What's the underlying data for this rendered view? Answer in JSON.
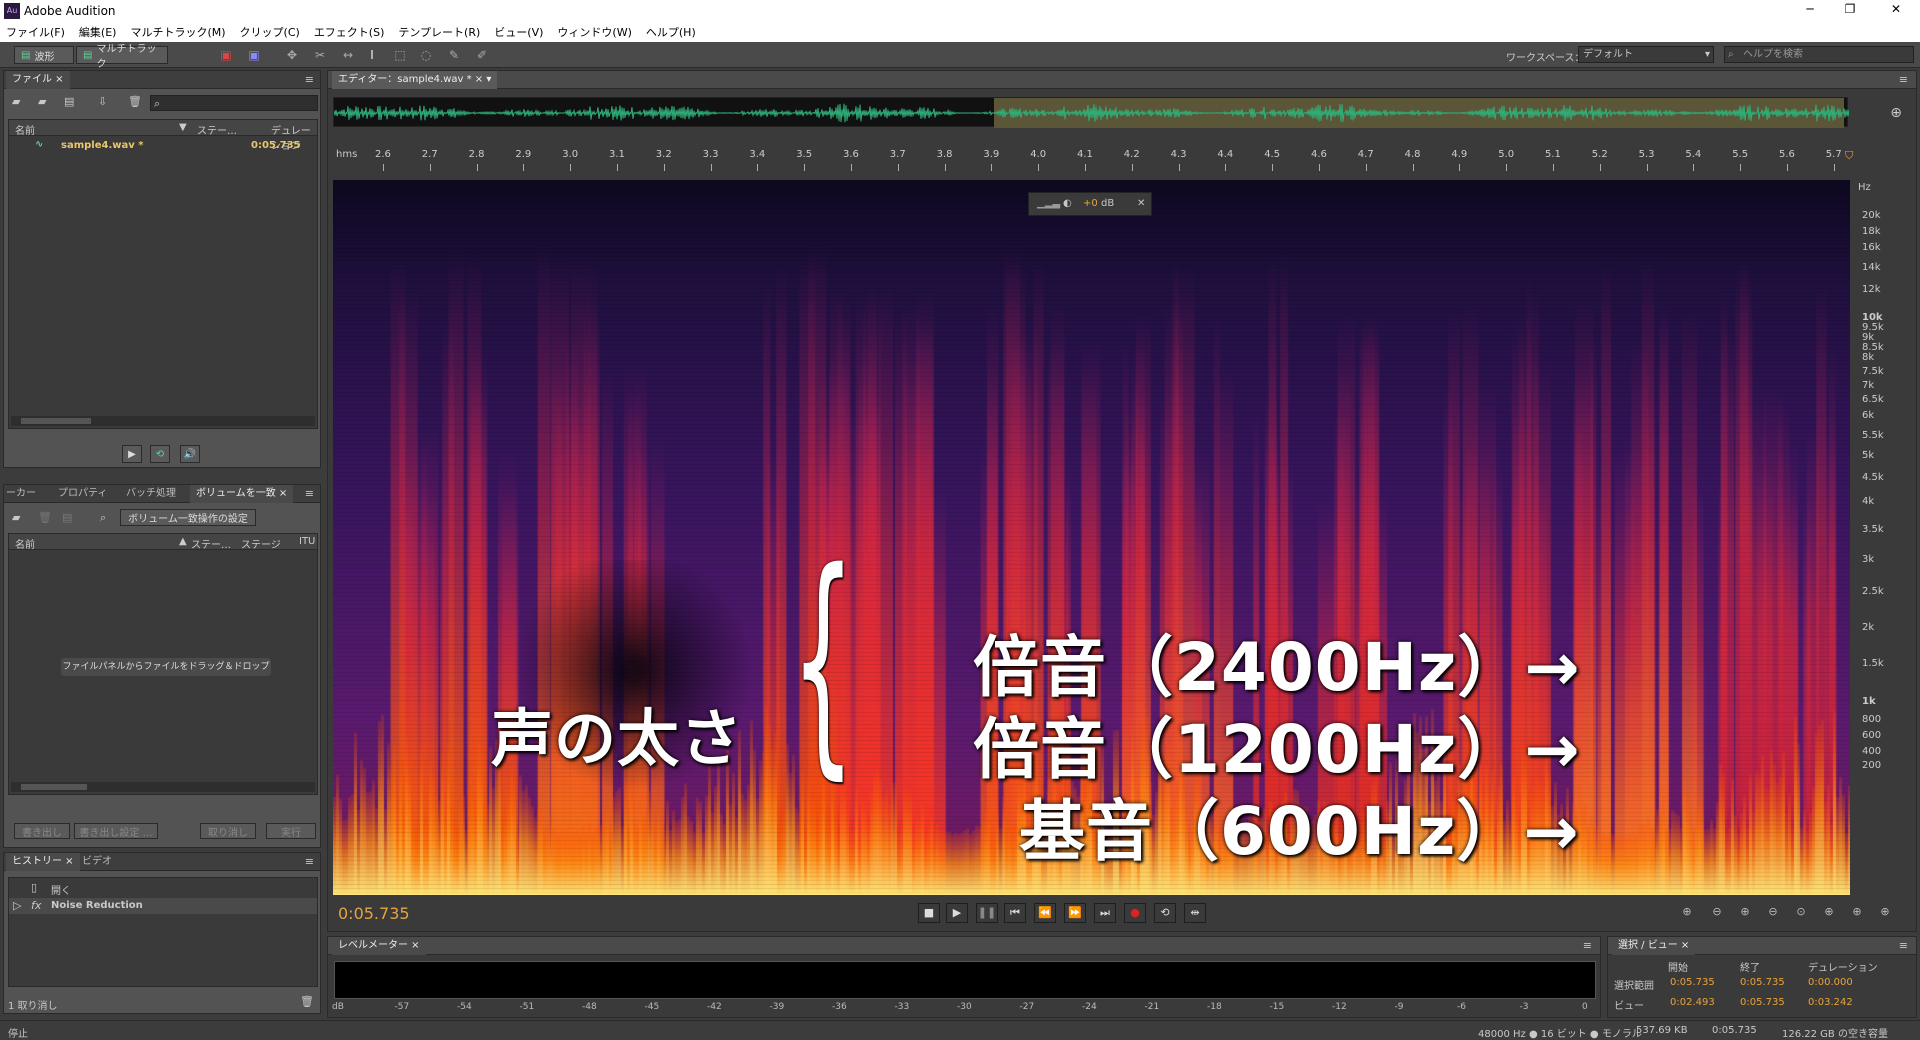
{
  "app": {
    "title": "Adobe Audition",
    "logo": "Au"
  },
  "window_controls": {
    "minimize": "─",
    "maximize": "❐",
    "close": "✕"
  },
  "menu": [
    "ファイル(F)",
    "編集(E)",
    "マルチトラック(M)",
    "クリップ(C)",
    "エフェクト(S)",
    "テンプレート(R)",
    "ビュー(V)",
    "ウィンドウ(W)",
    "ヘルプ(H)"
  ],
  "toolbar": {
    "waveform_label": "波形",
    "multitrack_label": "マルチトラック",
    "workspace_label": "ワークスペース：",
    "workspace_value": "デフォルト",
    "help_placeholder": "ヘルプを検索"
  },
  "files_panel": {
    "tab": "ファイル",
    "col_name": "名前",
    "col_status": "ステー…",
    "col_duration": "デュレーション",
    "rows": [
      {
        "name": "sample4.wav *",
        "duration": "0:05.735"
      }
    ]
  },
  "lower_panel": {
    "tabs": [
      "ーカー",
      "プロパティ",
      "バッチ処理",
      "ボリュームを一致"
    ],
    "match_settings_label": "ボリューム一致操作の設定",
    "col_name": "名前",
    "col_status": "ステー…",
    "col_stage": "ステージ",
    "col_itu": "ITU",
    "hint": "ファイルパネルからファイルをドラッグ＆ドロップ",
    "export_label": "書き出し",
    "export_settings_label": "書き出し設定 …",
    "cancel_label": "取り消し",
    "run_label": "実行"
  },
  "history_panel": {
    "tabs": [
      "ヒストリー",
      "ビデオ"
    ],
    "items": [
      "開く",
      "Noise Reduction"
    ],
    "undo_count": "1 取り消し"
  },
  "editor": {
    "tab": "エディター：sample4.wav *",
    "time_unit": "hms",
    "ticks": [
      "2.6",
      "2.7",
      "2.8",
      "2.9",
      "3.0",
      "3.1",
      "3.2",
      "3.3",
      "3.4",
      "3.5",
      "3.6",
      "3.7",
      "3.8",
      "3.9",
      "4.0",
      "4.1",
      "4.2",
      "4.3",
      "4.4",
      "4.5",
      "4.6",
      "4.7",
      "4.8",
      "4.9",
      "5.0",
      "5.1",
      "5.2",
      "5.3",
      "5.4",
      "5.5",
      "5.6",
      "5.7"
    ],
    "gain_value": "+0",
    "gain_unit": "dB",
    "current_time": "0:05.735"
  },
  "freq_axis": {
    "unit": "Hz",
    "labels": [
      "20k",
      "18k",
      "16k",
      "14k",
      "12k",
      "10k",
      "9.5k",
      "9k",
      "8.5k",
      "8k",
      "7.5k",
      "7k",
      "6.5k",
      "6k",
      "5.5k",
      "5k",
      "4.5k",
      "4k",
      "3.5k",
      "3k",
      "2.5k",
      "2k",
      "1.5k",
      "1k",
      "800",
      "600",
      "400",
      "200"
    ]
  },
  "annotations": {
    "voice_thickness": "声の太さ",
    "brace": "{",
    "overtone2": "倍音（2400Hz）→",
    "overtone1": "倍音（1200Hz）→",
    "fundamental": "基音（600Hz）→"
  },
  "level_meter": {
    "tab": "レベルメーター",
    "labels": [
      "dB",
      "-57",
      "-54",
      "-51",
      "-48",
      "-45",
      "-42",
      "-39",
      "-36",
      "-33",
      "-30",
      "-27",
      "-24",
      "-21",
      "-18",
      "-15",
      "-12",
      "-9",
      "-6",
      "-3",
      "0"
    ]
  },
  "selection_panel": {
    "tab": "選択 / ビュー",
    "col_start": "開始",
    "col_end": "終了",
    "col_duration": "デュレーション",
    "sel_label": "選択範囲",
    "sel_start": "0:05.735",
    "sel_end": "0:05.735",
    "sel_duration": "0:00.000",
    "view_label": "ビュー",
    "view_start": "0:02.493",
    "view_end": "0:05.735",
    "view_duration": "0:03.242"
  },
  "status": {
    "left": "停止",
    "format": "48000 Hz ● 16 ビット ● モノラル",
    "size": "537.69 KB",
    "duration": "0:05.735",
    "free": "126.22 GB の空き容量"
  },
  "colors": {
    "accent": "#e8a33a",
    "spectrogram_bg": "#1a0a2e",
    "waveform": "#2fb07a"
  }
}
